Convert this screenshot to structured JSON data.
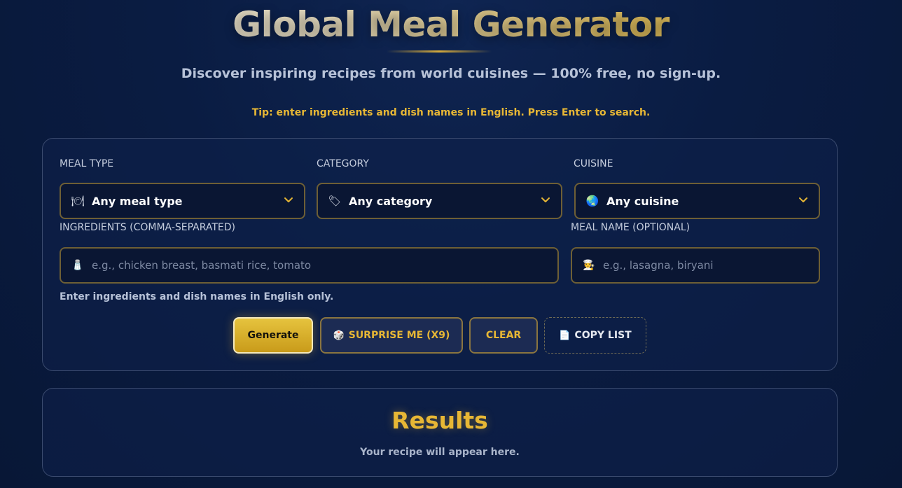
{
  "header": {
    "title": "Global Meal Generator",
    "subtitle": "Discover inspiring recipes from world cuisines — 100% free, no sign-up.",
    "tip": "Tip: enter ingredients and dish names in English. Press Enter to search."
  },
  "form": {
    "meal_type": {
      "label": "MEAL TYPE",
      "value": "Any meal type",
      "icon": "plate-icon"
    },
    "category": {
      "label": "CATEGORY",
      "value": "Any category",
      "icon": "tag-icon"
    },
    "cuisine": {
      "label": "CUISINE",
      "value": "Any cuisine",
      "icon": "globe-icon"
    },
    "ingredients": {
      "label": "INGREDIENTS (COMMA-SEPARATED)",
      "placeholder": "e.g., chicken breast, basmati rice, tomato",
      "icon": "salt-shaker-icon"
    },
    "meal_name": {
      "label": "MEAL NAME (OPTIONAL)",
      "placeholder": "e.g., lasagna, biryani",
      "icon": "chef-icon"
    },
    "hint": "Enter ingredients and dish names in English only."
  },
  "buttons": {
    "generate": "Generate",
    "surprise": "SURPRISE ME (X9)",
    "clear": "CLEAR",
    "copy": "COPY LIST"
  },
  "results": {
    "title": "Results",
    "placeholder": "Your recipe will appear here."
  },
  "colors": {
    "accent_gold": "#e7b735",
    "background": "#0a1c42",
    "border_gold": "#6e5f35"
  }
}
